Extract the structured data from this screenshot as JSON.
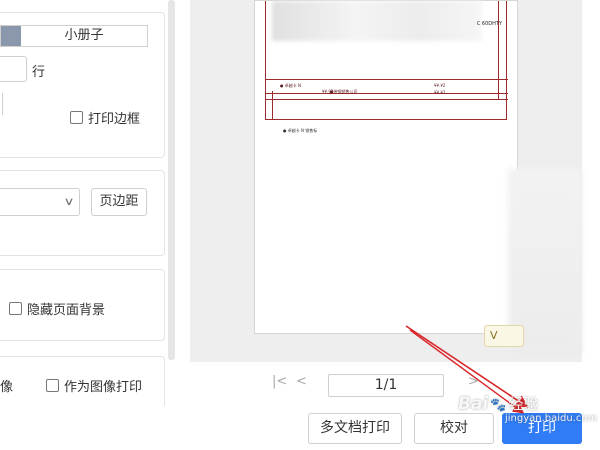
{
  "left_panel": {
    "layout_mode_option": "小册子",
    "rows_label": "行",
    "print_border_label": "打印边框",
    "page_margin_button": "页边距",
    "hide_background_label": "隐藏页面背景",
    "partial_label": "像",
    "print_as_image_label": "作为图像打印"
  },
  "preview": {
    "doc_code": "C 60DHTY",
    "row_texts": [
      "● 卓越卡 N",
      "¥¥.92",
      "●带钢销售公司",
      "¥¥.¥2",
      "¥¥.¥2"
    ],
    "note_text": "● 卓越卡 N  销售标",
    "badge": "V"
  },
  "pager": {
    "first_icon": "first-page-icon",
    "prev_icon": "prev-page-icon",
    "next_icon": "next-page-icon",
    "page_info": "1/1"
  },
  "actions": {
    "multi_doc_print": "多文档打印",
    "proofread": "校对",
    "print": "打印"
  },
  "watermark": {
    "brand": "Bai",
    "text": "经验",
    "url": "jingyan.baidu.com"
  },
  "colors": {
    "primary": "#2f7cf6",
    "annotation_arrow": "#d8262a",
    "preview_bg": "#eeeeee",
    "doc_border": "#9b2a2a"
  }
}
